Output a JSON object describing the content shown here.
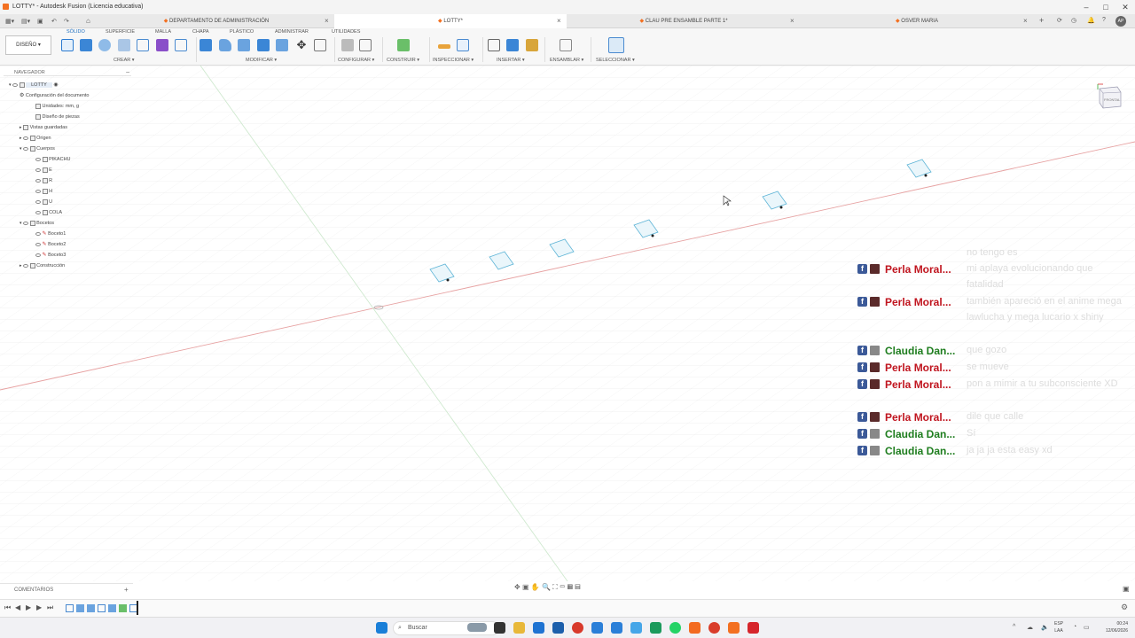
{
  "window": {
    "title": "LOTTY* - Autodesk Fusion (Licencia educativa)"
  },
  "tabs": [
    {
      "label": "DEPARTAMENTO DE ADMINISTRACIÓN",
      "active": false
    },
    {
      "label": "LOTTY*",
      "active": true
    },
    {
      "label": "CLAU PRE ENSAMBLE PARTE 1*",
      "active": false
    },
    {
      "label": "OSVER MARIA",
      "active": false
    }
  ],
  "toolbar": {
    "workspace": "DISEÑO",
    "tabs": [
      "SÓLIDO",
      "SUPERFICIE",
      "MALLA",
      "CHAPA",
      "PLÁSTICO",
      "ADMINISTRAR",
      "UTILIDADES"
    ],
    "groups": [
      "CREAR",
      "MODIFICAR",
      "CONFIGURAR",
      "CONSTRUIR",
      "INSPECCIONAR",
      "INSERTAR",
      "ENSAMBLAR",
      "SELECCIONAR"
    ]
  },
  "navigator": {
    "title": "NAVEGADOR",
    "root": "LOTTY",
    "items": [
      "Configuración del documento",
      "Unidades: mm, g",
      "Diseño de piezas",
      "Vistas guardadas",
      "Origen",
      "Cuerpos",
      "PIKACHU",
      "E",
      "R",
      "H",
      "U",
      "COLA",
      "Bocetos",
      "Boceto1",
      "Boceto2",
      "Boceto3",
      "Construcción"
    ]
  },
  "viewcube": {
    "label": "FRONTAL"
  },
  "comments": [
    {
      "name": "Perla Moral...",
      "text": "no tengo es",
      "color": "#c0151f"
    },
    {
      "name": "Perla Moral...",
      "text": "mi aplaya evolucionando que fatalidad",
      "color": "#c0151f"
    },
    {
      "name": "Perla Moral...",
      "text": "también apareció en el anime mega lawlucha y mega lucario x shiny",
      "color": "#c0151f"
    },
    {
      "name": "Claudia Dan...",
      "text": "que gozo",
      "color": "#1e7d1e"
    },
    {
      "name": "Perla Moral...",
      "text": "se mueve",
      "color": "#c0151f"
    },
    {
      "name": "Perla Moral...",
      "text": "pon a mimir a tu subconsciente XD",
      "color": "#c0151f"
    },
    {
      "name": "Perla Moral...",
      "text": "dile que calle",
      "color": "#c0151f"
    },
    {
      "name": "Claudia Dan...",
      "text": "Sí",
      "color": "#1e7d1e"
    },
    {
      "name": "Claudia Dan...",
      "text": "ja ja ja esta easy xd",
      "color": "#1e7d1e"
    }
  ],
  "comments_panel": {
    "label": "COMENTARIOS"
  },
  "taskbar": {
    "search_placeholder": "Buscar",
    "lang": "ESP",
    "lang2": "LAA",
    "time": "00:24",
    "date": "12/06/2026"
  }
}
